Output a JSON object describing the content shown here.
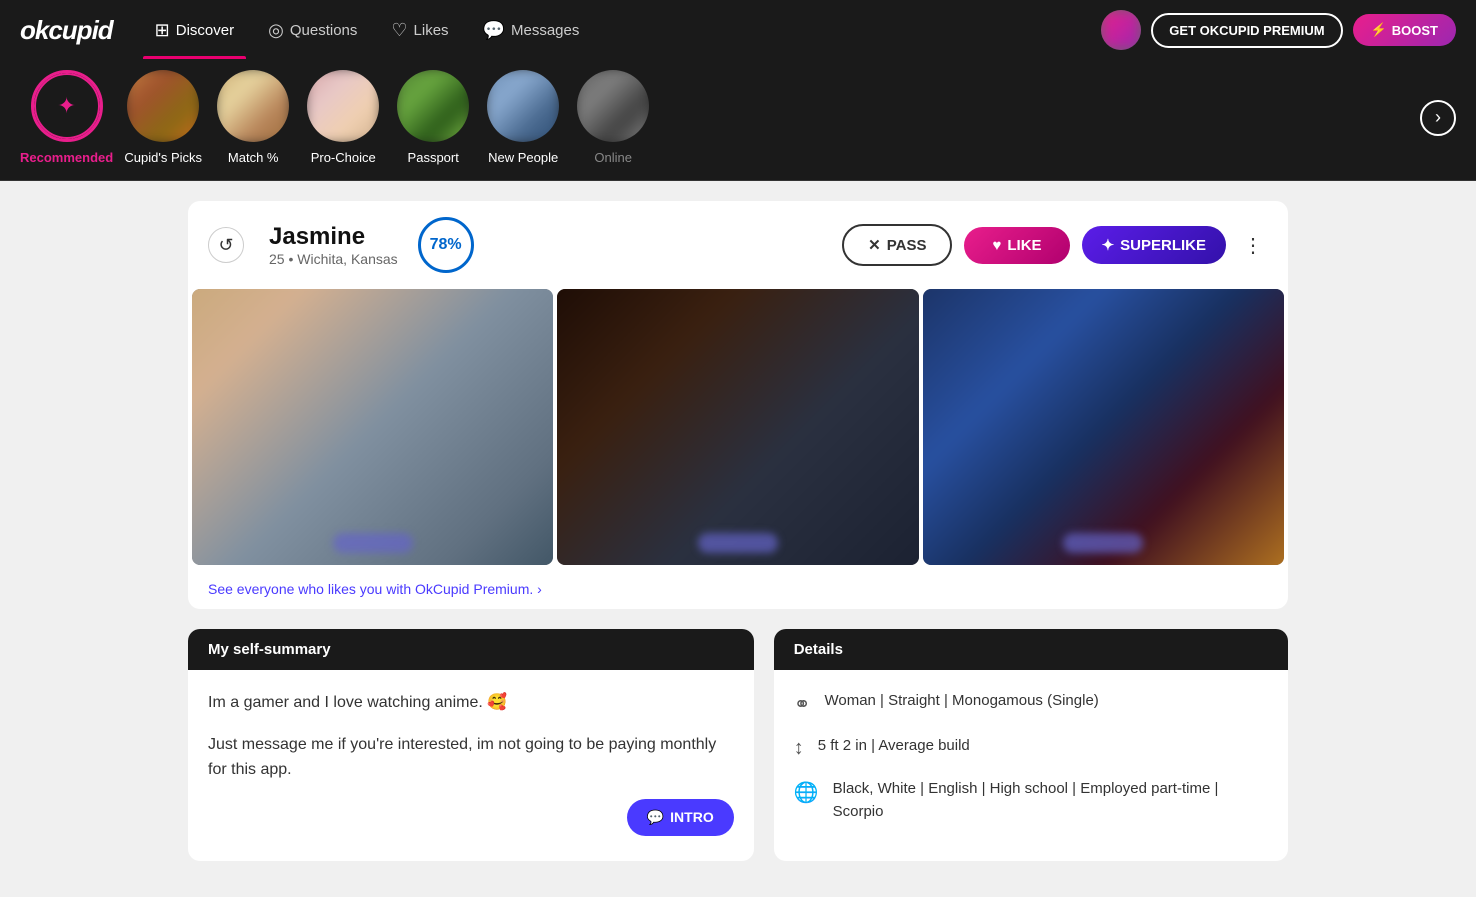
{
  "app": {
    "logo": "okcupid",
    "nav": {
      "items": [
        {
          "label": "Discover",
          "icon": "🔲",
          "active": true,
          "id": "discover"
        },
        {
          "label": "Questions",
          "icon": "❓",
          "active": false,
          "id": "questions"
        },
        {
          "label": "Likes",
          "icon": "♡",
          "active": false,
          "id": "likes"
        },
        {
          "label": "Messages",
          "icon": "💬",
          "active": false,
          "id": "messages"
        }
      ],
      "premium_btn": "GET OKCUPID PREMIUM",
      "boost_btn": "BOOST"
    },
    "categories": [
      {
        "label": "Recommended",
        "active": true,
        "icon": "☀",
        "id": "recommended"
      },
      {
        "label": "Cupid's Picks",
        "active": false,
        "id": "cupids-picks"
      },
      {
        "label": "Match %",
        "active": false,
        "id": "match"
      },
      {
        "label": "Pro-Choice",
        "active": false,
        "id": "pro-choice"
      },
      {
        "label": "Passport",
        "active": false,
        "id": "passport"
      },
      {
        "label": "New People",
        "active": false,
        "id": "new-people"
      },
      {
        "label": "Online",
        "active": false,
        "id": "online"
      }
    ]
  },
  "profile": {
    "name": "Jasmine",
    "age": "25",
    "location": "Wichita, Kansas",
    "match_percent": "78%",
    "actions": {
      "pass": "PASS",
      "like": "LIKE",
      "superlike": "SUPERLIKE"
    },
    "likes_banner": "See everyone who likes you with OkCupid Premium. ›",
    "self_summary": {
      "header": "My self-summary",
      "text1": "Im a gamer and I love watching anime. 🥰",
      "text2": "Just message me if you're interested, im not going to be paying monthly for this app.",
      "intro_btn": "INTRO"
    },
    "details": {
      "header": "Details",
      "row1": "Woman | Straight | Monogamous (Single)",
      "row2": "5 ft 2 in | Average build",
      "row3": "Black, White | English | High school | Employed part-time | Scorpio"
    }
  }
}
